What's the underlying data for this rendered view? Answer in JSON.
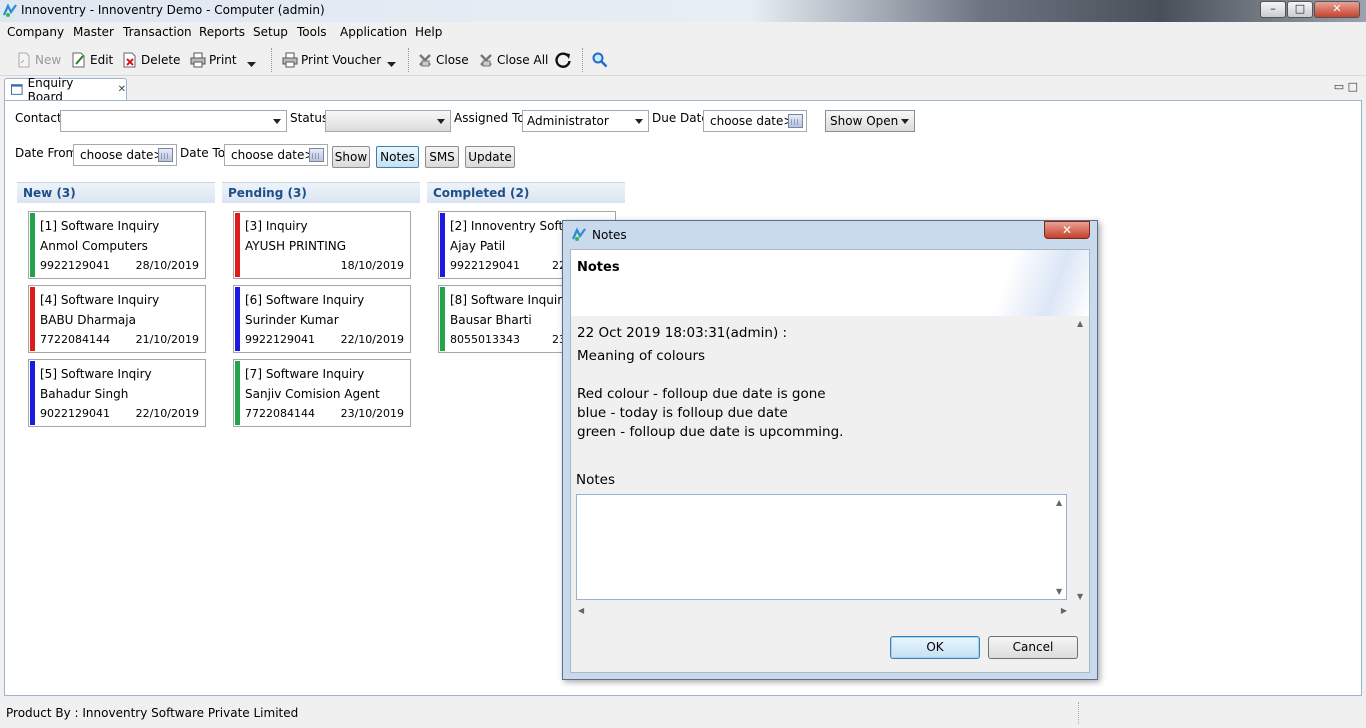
{
  "window": {
    "title": "Innoventry - Innoventry Demo - Computer  (admin)",
    "controls": {
      "minimize": "–",
      "maximize": "□",
      "close": "✕"
    }
  },
  "menu": [
    "Company",
    "Master",
    "Transaction",
    "Reports",
    "Setup",
    "Tools",
    "Application",
    "Help"
  ],
  "toolbar": {
    "new": "New",
    "edit": "Edit",
    "delete": "Delete",
    "print": "Print",
    "print_voucher": "Print Voucher",
    "close": "Close",
    "close_all": "Close All"
  },
  "tab": {
    "label": "Enquiry Board",
    "close": "✕"
  },
  "filters": {
    "contact_label": "Contact",
    "contact_value": "",
    "status_label": "Status",
    "status_value": "",
    "assigned_label": "Assigned To",
    "assigned_value": "Administrator",
    "due_label": "Due Date",
    "due_value": "choose date>",
    "show_open": "Show Open",
    "date_from_label": "Date From",
    "date_from_value": "choose date>",
    "date_to_label": "Date To",
    "date_to_value": "choose date>",
    "show_btn": "Show",
    "notes_btn": "Notes",
    "sms_btn": "SMS",
    "update_btn": "Update"
  },
  "columns": [
    {
      "title": "New (3)",
      "cards": [
        {
          "l1": "[1] Software Inquiry",
          "l2": "Anmol Computers",
          "phone": "9922129041",
          "date": "28/10/2019",
          "color": "#22a44a"
        },
        {
          "l1": "[4] Software Inquiry",
          "l2": "BABU Dharmaja",
          "phone": "7722084144",
          "date": "21/10/2019",
          "color": "#e01b1b"
        },
        {
          "l1": "[5] Software Inqiry",
          "l2": "Bahadur Singh",
          "phone": "9022129041",
          "date": "22/10/2019",
          "color": "#1a1ae0"
        }
      ]
    },
    {
      "title": "Pending (3)",
      "cards": [
        {
          "l1": "[3] Inquiry",
          "l2": "AYUSH PRINTING",
          "phone": "",
          "date": "18/10/2019",
          "color": "#e01b1b"
        },
        {
          "l1": "[6] Software Inquiry",
          "l2": "Surinder Kumar",
          "phone": "9922129041",
          "date": "22/10/2019",
          "color": "#1a1ae0"
        },
        {
          "l1": "[7] Software Inquiry",
          "l2": "Sanjiv Comision Agent",
          "phone": "7722084144",
          "date": "23/10/2019",
          "color": "#22a44a"
        }
      ]
    },
    {
      "title": "Completed (2)",
      "cards": [
        {
          "l1": "[2] Innoventry Software",
          "l2": "Ajay Patil",
          "phone": "9922129041",
          "date": "22",
          "color": "#1a1ae0"
        },
        {
          "l1": "[8] Software Inquiry",
          "l2": "Bausar Bharti",
          "phone": "8055013343",
          "date": "23",
          "color": "#22a44a"
        }
      ]
    }
  ],
  "dialog": {
    "title": "Notes",
    "close": "✕",
    "header": "Notes",
    "history_date": "22 Oct 2019 18:03:31(admin) :",
    "history_lines": [
      "Meaning of colours",
      "",
      "Red colour - folloup due date is gone",
      "blue - today is folloup due date",
      "green - folloup due date is upcomming."
    ],
    "notes_label": "Notes",
    "notes_value": "",
    "ok": "OK",
    "cancel": "Cancel"
  },
  "status": {
    "text": "Product By : Innoventry Software Private Limited"
  }
}
